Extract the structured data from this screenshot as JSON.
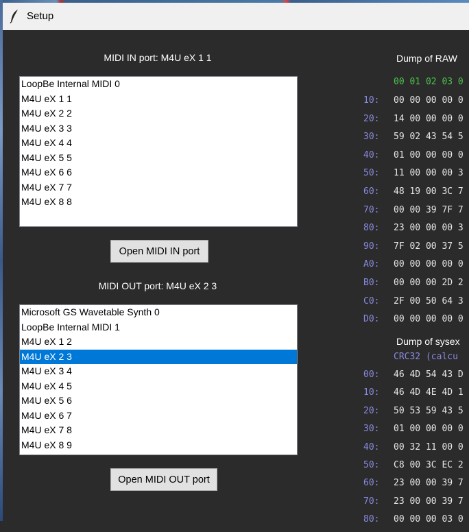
{
  "window": {
    "title": "Setup"
  },
  "midi_in": {
    "label": "MIDI IN port: M4U eX 1 1",
    "items": [
      "LoopBe Internal MIDI 0",
      "M4U eX 1 1",
      "M4U eX 2 2",
      "M4U eX 3 3",
      "M4U eX 4 4",
      "M4U eX 5 5",
      "M4U eX 6 6",
      "M4U eX 7 7",
      "M4U eX 8 8"
    ],
    "button": "Open MIDI IN port"
  },
  "midi_out": {
    "label": "MIDI OUT port: M4U eX 2 3",
    "items": [
      "Microsoft GS Wavetable Synth 0",
      "LoopBe Internal MIDI 1",
      "M4U eX 1 2",
      "M4U eX 2 3",
      "M4U eX 3 4",
      "M4U eX 4 5",
      "M4U eX 5 6",
      "M4U eX 6 7",
      "M4U eX 7 8",
      "M4U eX 8 9"
    ],
    "selected": "M4U eX 2 3",
    "button": "Open MIDI OUT port"
  },
  "raw_dump": {
    "title": "Dump of RAW",
    "header": "00 01 02 03 0",
    "rows": [
      {
        "addr": "10:",
        "bytes": "00 00 00 00 0"
      },
      {
        "addr": "20:",
        "bytes": "14 00 00 00 0"
      },
      {
        "addr": "30:",
        "bytes": "59 02 43 54 5"
      },
      {
        "addr": "40:",
        "bytes": "01 00 00 00 0"
      },
      {
        "addr": "50:",
        "bytes": "11 00 00 00 3"
      },
      {
        "addr": "60:",
        "bytes": "48 19 00 3C 7"
      },
      {
        "addr": "70:",
        "bytes": "00 00 39 7F 7"
      },
      {
        "addr": "80:",
        "bytes": "23 00 00 00 3"
      },
      {
        "addr": "90:",
        "bytes": "7F 02 00 37 5"
      },
      {
        "addr": "A0:",
        "bytes": "00 00 00 00 0"
      },
      {
        "addr": "B0:",
        "bytes": "00 00 00 2D 2"
      },
      {
        "addr": "C0:",
        "bytes": "2F 00 50 64 3"
      },
      {
        "addr": "D0:",
        "bytes": "00 00 00 00 0"
      }
    ]
  },
  "sysex_dump": {
    "title": "Dump of sysex",
    "crc": "CRC32 (calcu",
    "rows": [
      {
        "addr": "00:",
        "bytes": "46 4D 54 43 D"
      },
      {
        "addr": "10:",
        "bytes": "46 4D 4E 4D 1"
      },
      {
        "addr": "20:",
        "bytes": "50 53 59 43 5"
      },
      {
        "addr": "30:",
        "bytes": "01 00 00 00 0"
      },
      {
        "addr": "40:",
        "bytes": "00 32 11 00 0"
      },
      {
        "addr": "50:",
        "bytes": "C8 00 3C EC 2"
      },
      {
        "addr": "60:",
        "bytes": "23 00 00 39 7"
      },
      {
        "addr": "70:",
        "bytes": "23 00 00 39 7"
      },
      {
        "addr": "80:",
        "bytes": "00 00 00 03 0"
      }
    ]
  }
}
